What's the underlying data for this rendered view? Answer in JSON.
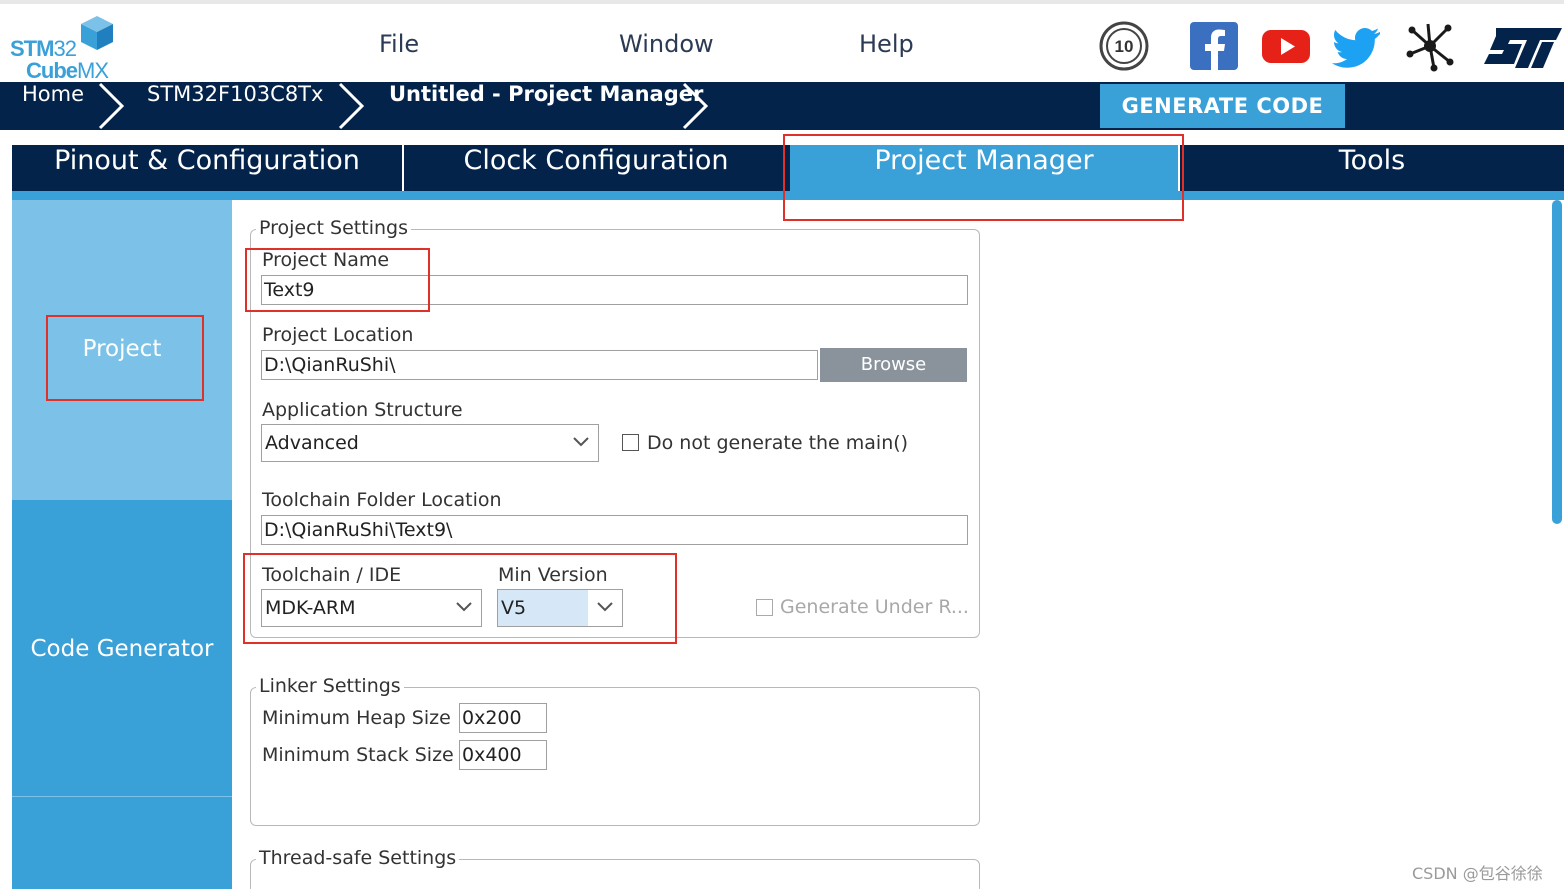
{
  "app": {
    "logo_line1_bold": "STM",
    "logo_line1_thin": "32",
    "logo_line2_bold": "Cube",
    "logo_line2_thin": "MX"
  },
  "menu": {
    "file": "File",
    "window": "Window",
    "help": "Help"
  },
  "social_icons": [
    "anniversary-10-icon",
    "facebook-icon",
    "youtube-icon",
    "twitter-icon",
    "network-icon",
    "st-logo-icon"
  ],
  "breadcrumb": {
    "home": "Home",
    "mcu": "STM32F103C8Tx",
    "current": "Untitled - Project Manager"
  },
  "generate_button": "GENERATE CODE",
  "tabs": {
    "pinout": "Pinout & Configuration",
    "clock": "Clock Configuration",
    "project_manager": "Project Manager",
    "tools": "Tools"
  },
  "sidebar": {
    "project": "Project",
    "code_generator": "Code Generator"
  },
  "project_settings": {
    "legend": "Project Settings",
    "project_name_label": "Project Name",
    "project_name_value": "Text9",
    "project_location_label": "Project Location",
    "project_location_value": "D:\\QianRuShi\\",
    "browse": "Browse",
    "app_structure_label": "Application Structure",
    "app_structure_value": "Advanced",
    "do_not_generate_main": "Do not generate the main()",
    "toolchain_folder_label": "Toolchain Folder Location",
    "toolchain_folder_value": "D:\\QianRuShi\\Text9\\",
    "toolchain_label": "Toolchain / IDE",
    "toolchain_value": "MDK-ARM",
    "min_version_label": "Min Version",
    "min_version_value": "V5",
    "generate_under_root": "Generate Under R..."
  },
  "linker_settings": {
    "legend": "Linker Settings",
    "heap_label": "Minimum Heap Size",
    "heap_value": "0x200",
    "stack_label": "Minimum Stack Size",
    "stack_value": "0x400"
  },
  "thread_safe": {
    "legend": "Thread-safe Settings"
  },
  "watermark": "CSDN @包谷徐徐",
  "colors": {
    "navy": "#03234b",
    "accent": "#3aa0d8",
    "sidebar_light": "#7cc2e8",
    "highlight_red": "#e0302a"
  }
}
